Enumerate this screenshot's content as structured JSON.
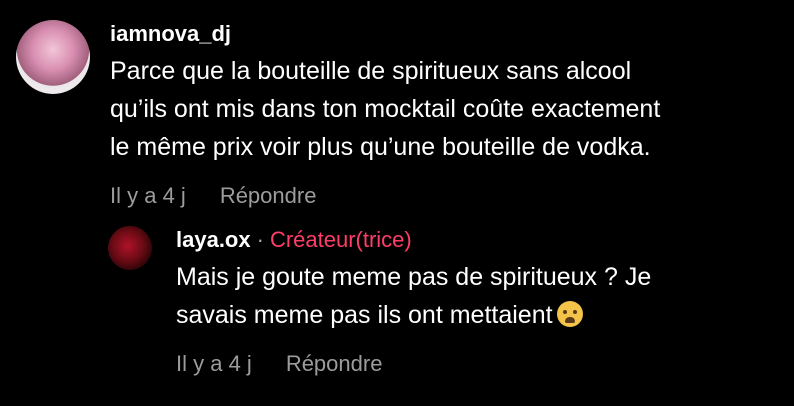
{
  "comments": [
    {
      "username": "iamnova_dj",
      "text": "Parce que la bouteille de spiritueux sans alcool\nqu’ils ont mis dans ton mocktail coûte exactement\nle même prix voir plus qu’une bouteille de vodka.",
      "time": "Il y a 4 j",
      "reply_label": "Répondre"
    }
  ],
  "reply": {
    "username": "laya.ox",
    "separator": "·",
    "creator_badge": "Créateur(trice)",
    "text": "Mais je goute meme pas de spiritueux ? Je\nsavais meme pas ils ont mettaient",
    "emoji_name": "loudly-crying-face-emoji",
    "time": "Il y a 4 j",
    "reply_label": "Répondre"
  },
  "colors": {
    "background": "#000000",
    "text": "#ffffff",
    "meta": "#9c9c9c",
    "creator_badge": "#ff3d68"
  }
}
